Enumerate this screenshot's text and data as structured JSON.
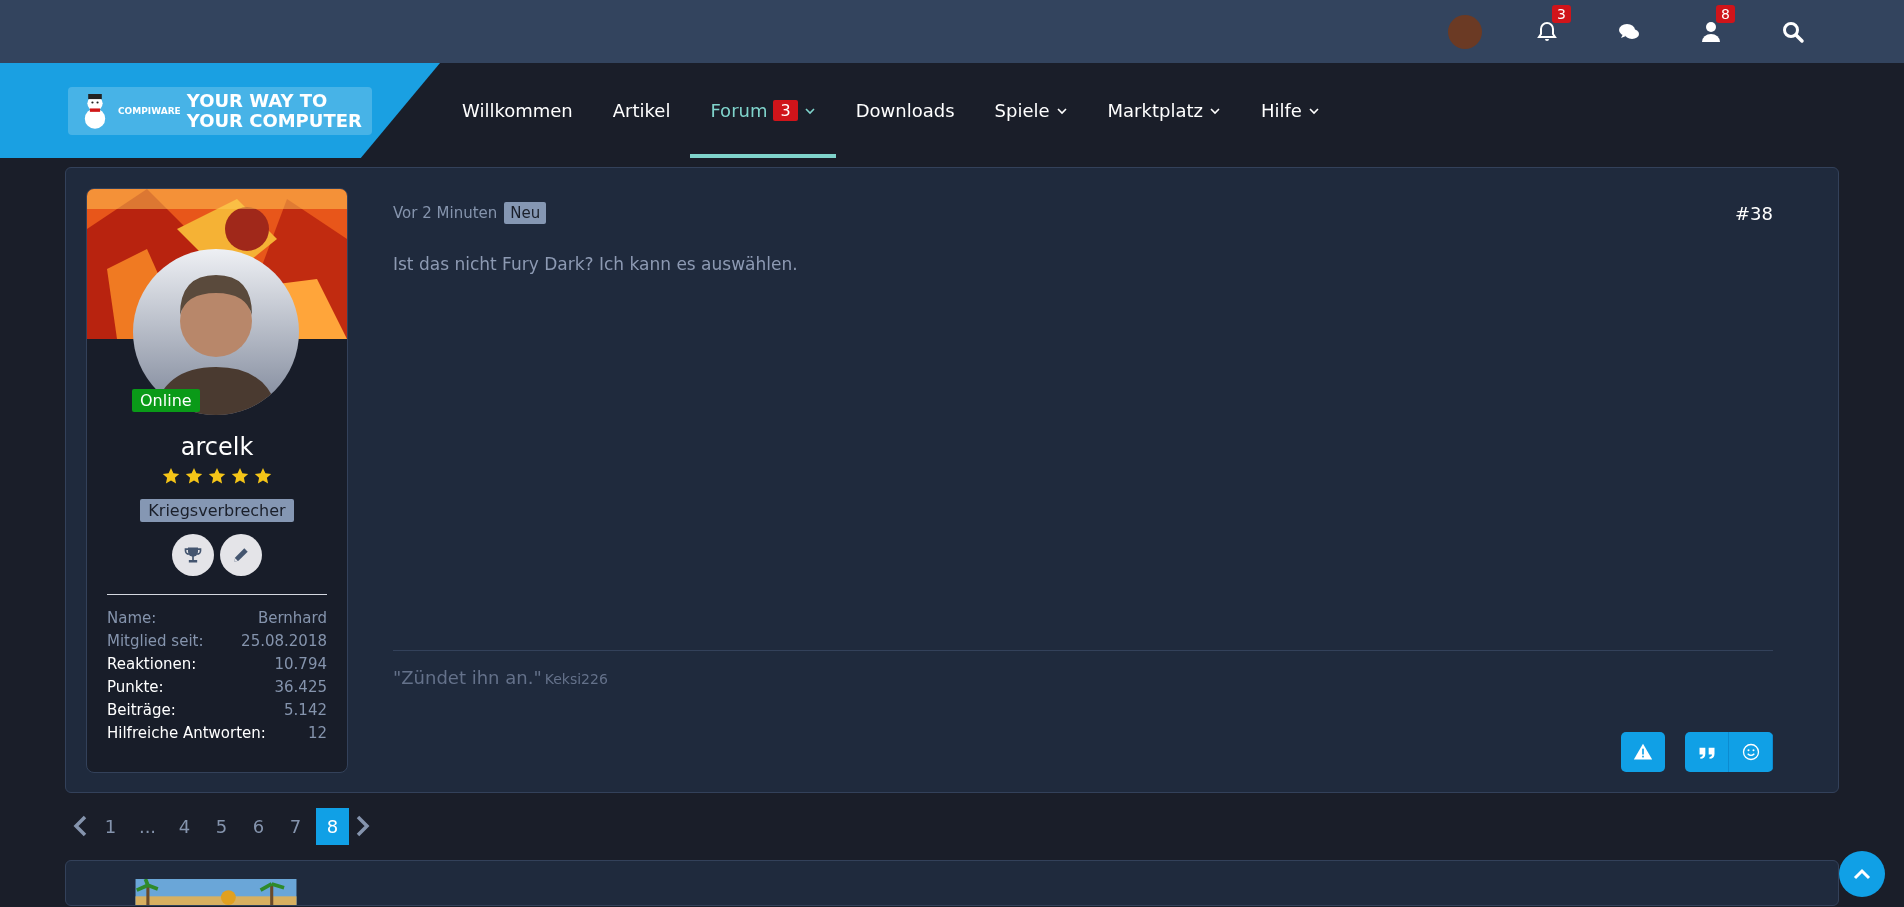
{
  "top_bar": {
    "items": [
      {
        "kind": "avatar"
      },
      {
        "kind": "bell",
        "badge": "3"
      },
      {
        "kind": "chat"
      },
      {
        "kind": "user",
        "badge": "8"
      },
      {
        "kind": "search"
      }
    ]
  },
  "nav": {
    "logo": {
      "small": "COMPIWARE",
      "line1": "YOUR WAY TO",
      "line2": "YOUR COMPUTER"
    },
    "items": [
      {
        "label": "Willkommen",
        "selected": false,
        "has_menu": false
      },
      {
        "label": "Artikel",
        "selected": false,
        "has_menu": false
      },
      {
        "label": "Forum",
        "selected": true,
        "has_menu": true,
        "badge": "3"
      },
      {
        "label": "Downloads",
        "selected": false,
        "has_menu": false
      },
      {
        "label": "Spiele",
        "selected": false,
        "has_menu": true
      },
      {
        "label": "Marktplatz",
        "selected": false,
        "has_menu": true
      },
      {
        "label": "Hilfe",
        "selected": false,
        "has_menu": true
      }
    ]
  },
  "post": {
    "user": {
      "status": "Online",
      "name": "arcelk",
      "stars": 5,
      "title": "Kriegsverbrecher",
      "stats": [
        {
          "label": "Name:",
          "value": "Bernhard",
          "emphasized": false
        },
        {
          "label": "Mitglied seit:",
          "value": "25.08.2018",
          "emphasized": false
        },
        {
          "label": "Reaktionen:",
          "value": "10.794",
          "emphasized": true
        },
        {
          "label": "Punkte:",
          "value": "36.425",
          "emphasized": true
        },
        {
          "label": "Beiträge:",
          "value": "5.142",
          "emphasized": true
        },
        {
          "label": "Hilfreiche Antworten:",
          "value": "12",
          "emphasized": true
        }
      ]
    },
    "time": "Vor 2 Minuten",
    "tag": "Neu",
    "number": "#38",
    "body": "Ist das nicht Fury Dark? Ich kann es auswählen.",
    "signature": {
      "quote": "\"Zündet ihn an.\"",
      "author": "Keksi226"
    }
  },
  "pagination": {
    "pages": [
      {
        "label": "1",
        "selected": false
      },
      {
        "label": "...",
        "selected": false
      },
      {
        "label": "4",
        "selected": false
      },
      {
        "label": "5",
        "selected": false
      },
      {
        "label": "6",
        "selected": false
      },
      {
        "label": "7",
        "selected": false
      },
      {
        "label": "8",
        "selected": true
      }
    ]
  }
}
